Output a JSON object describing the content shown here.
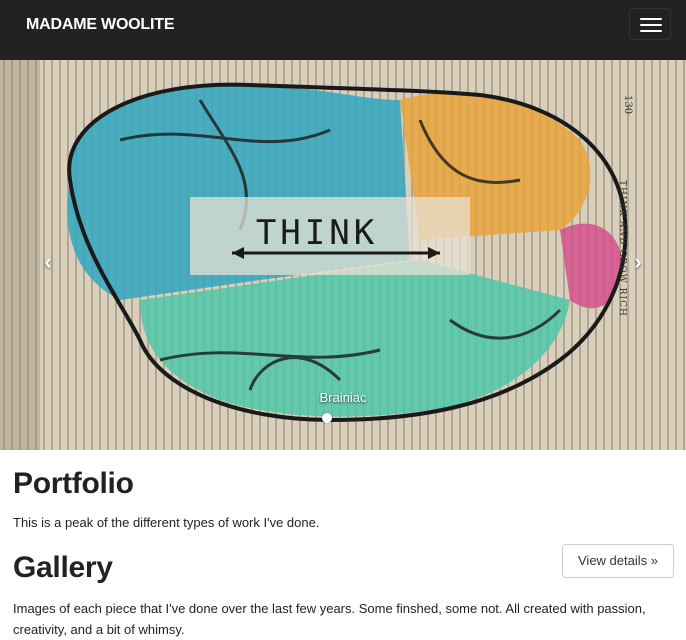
{
  "navbar": {
    "brand": "MADAME WOOLITE",
    "menu_icon": "hamburger-menu-icon",
    "background": "#222222"
  },
  "carousel": {
    "slide_title": "THINK",
    "caption": "Brainiac",
    "prev_icon": "chevron-left-icon",
    "next_icon": "chevron-right-icon",
    "prev_glyph": "‹",
    "next_glyph": "›",
    "indicator_count": 1,
    "active_indicator": 0,
    "page_number": "130",
    "running_head": "THINK AND GROW RICH"
  },
  "portfolio": {
    "heading": "Portfolio",
    "description": "This is a peak of the different types of work I've done."
  },
  "gallery": {
    "heading": "Gallery",
    "button_label": "View details »",
    "description": "Images of each piece that I've done over the last few years. Some finshed, some not. All created with passion, creativity, and a bit of whimsy."
  },
  "colors": {
    "text": "#222222",
    "brain_blue": "#2fa7bf",
    "brain_teal": "#4fc7a8",
    "brain_orange": "#e8a33c",
    "brain_pink": "#d4508c",
    "paper": "#d8cdb8"
  }
}
